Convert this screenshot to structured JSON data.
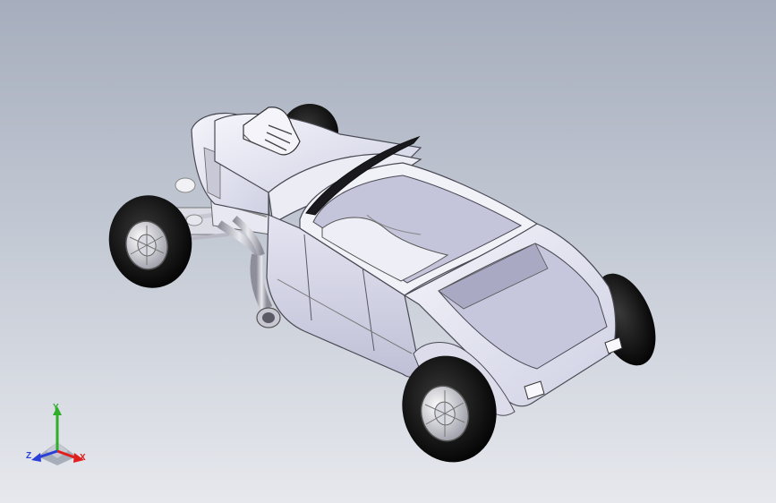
{
  "viewport": {
    "background_top": "#a6adbc",
    "background_bottom": "#e6e8ed",
    "model": "hot-rod-roadster"
  },
  "triad": {
    "x_label": "X",
    "y_label": "Y",
    "z_label": "Z",
    "x_color": "#e0201e",
    "y_color": "#2fae2a",
    "z_color": "#2a3fd8"
  }
}
